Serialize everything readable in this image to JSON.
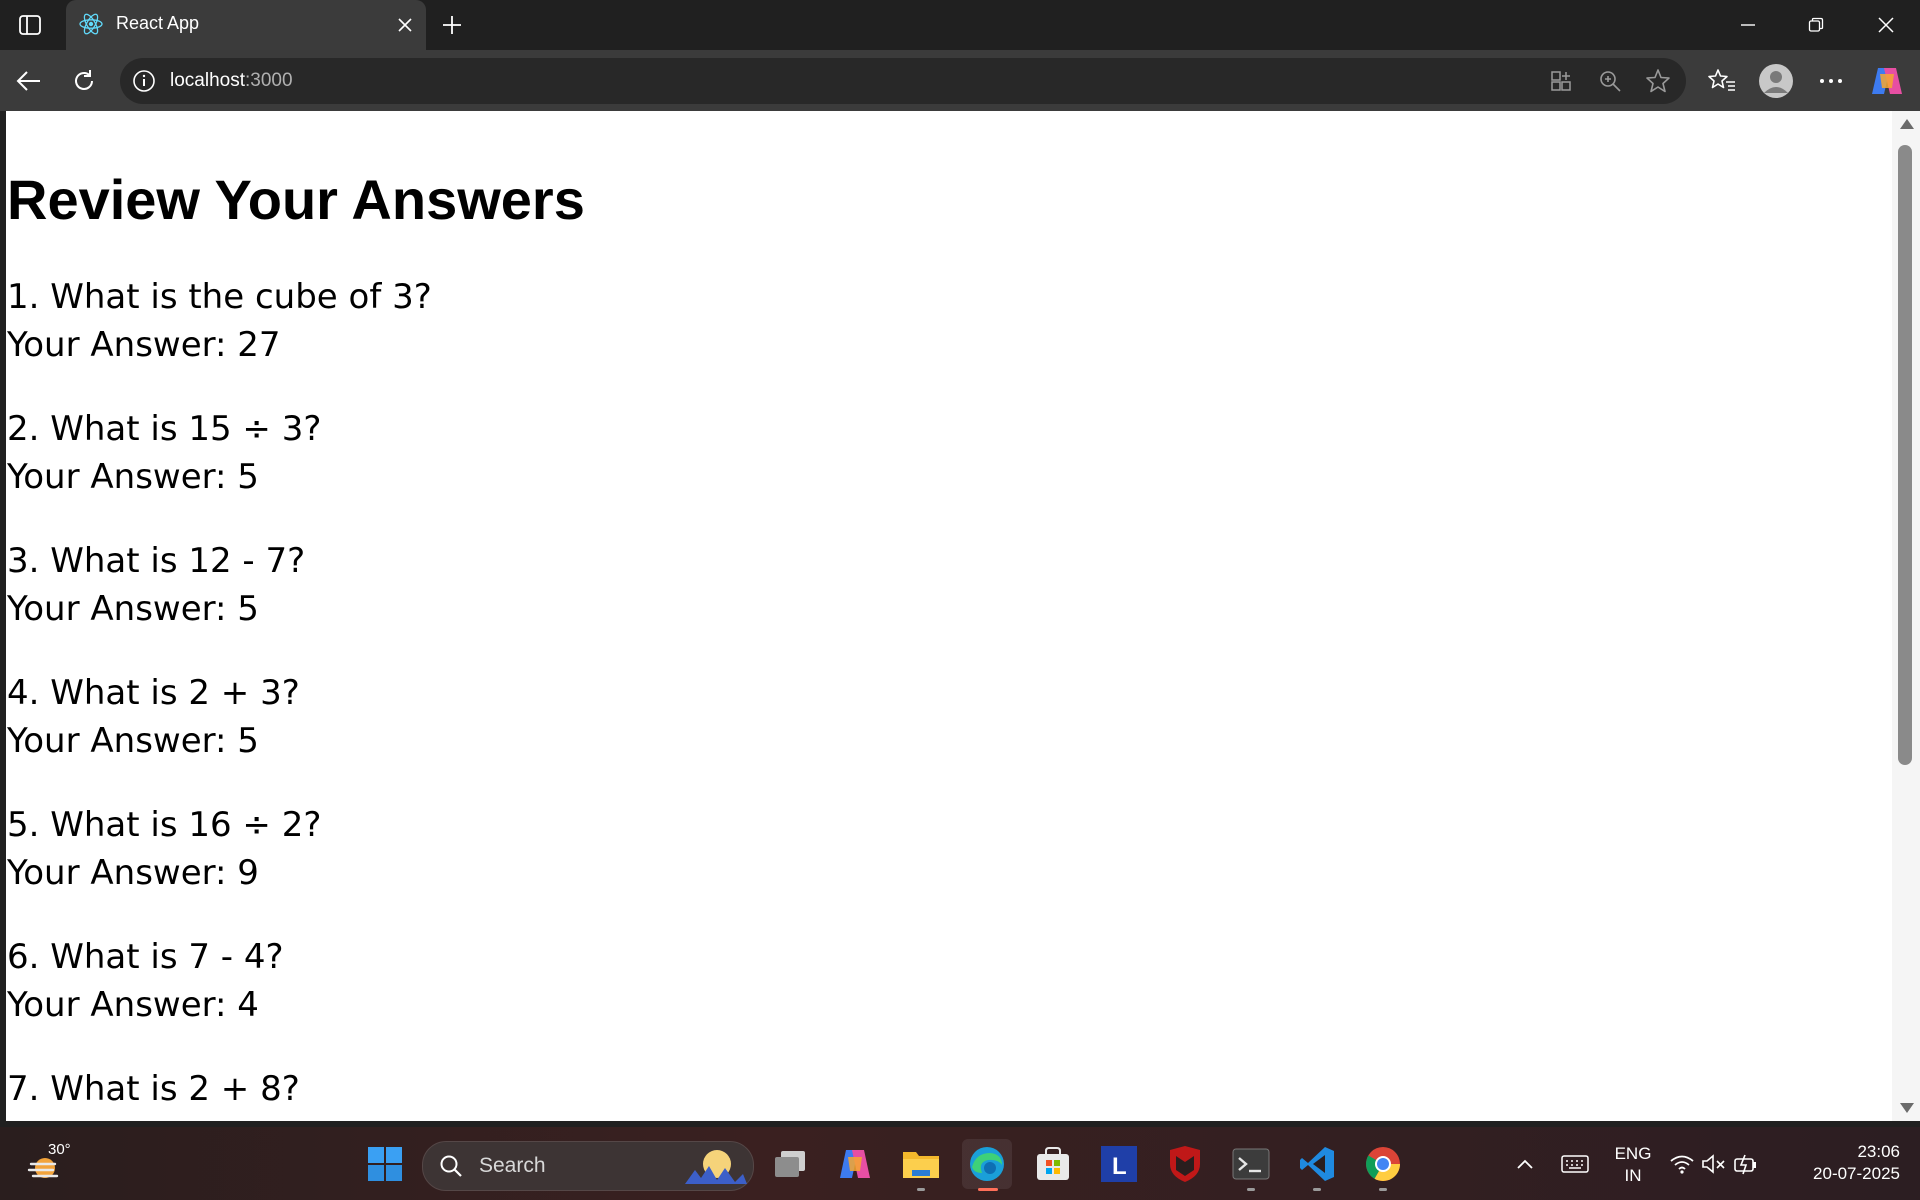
{
  "browser": {
    "tab_title": "React App",
    "url_host": "localhost",
    "url_port": ":3000"
  },
  "page": {
    "heading": "Review Your Answers",
    "items": [
      {
        "question": "1. What is the cube of 3?",
        "answer": "Your Answer: 27"
      },
      {
        "question": "2. What is 15 ÷ 3?",
        "answer": "Your Answer: 5"
      },
      {
        "question": "3. What is 12 - 7?",
        "answer": "Your Answer: 5"
      },
      {
        "question": "4. What is 2 + 3?",
        "answer": "Your Answer: 5"
      },
      {
        "question": "5. What is 16 ÷ 2?",
        "answer": "Your Answer: 9"
      },
      {
        "question": "6. What is 7 - 4?",
        "answer": "Your Answer: 4"
      },
      {
        "question": "7. What is 2 + 8?",
        "answer": ""
      }
    ]
  },
  "taskbar": {
    "weather_temp": "30°",
    "search_label": "Search",
    "lang_line1": "ENG",
    "lang_line2": "IN",
    "time": "23:06",
    "date": "20-07-2025"
  },
  "colors": {
    "tab_active": "#3b3b3b",
    "titlebar": "#202020",
    "page_bg": "#ffffff",
    "active_indicator": "#ff6f59"
  }
}
